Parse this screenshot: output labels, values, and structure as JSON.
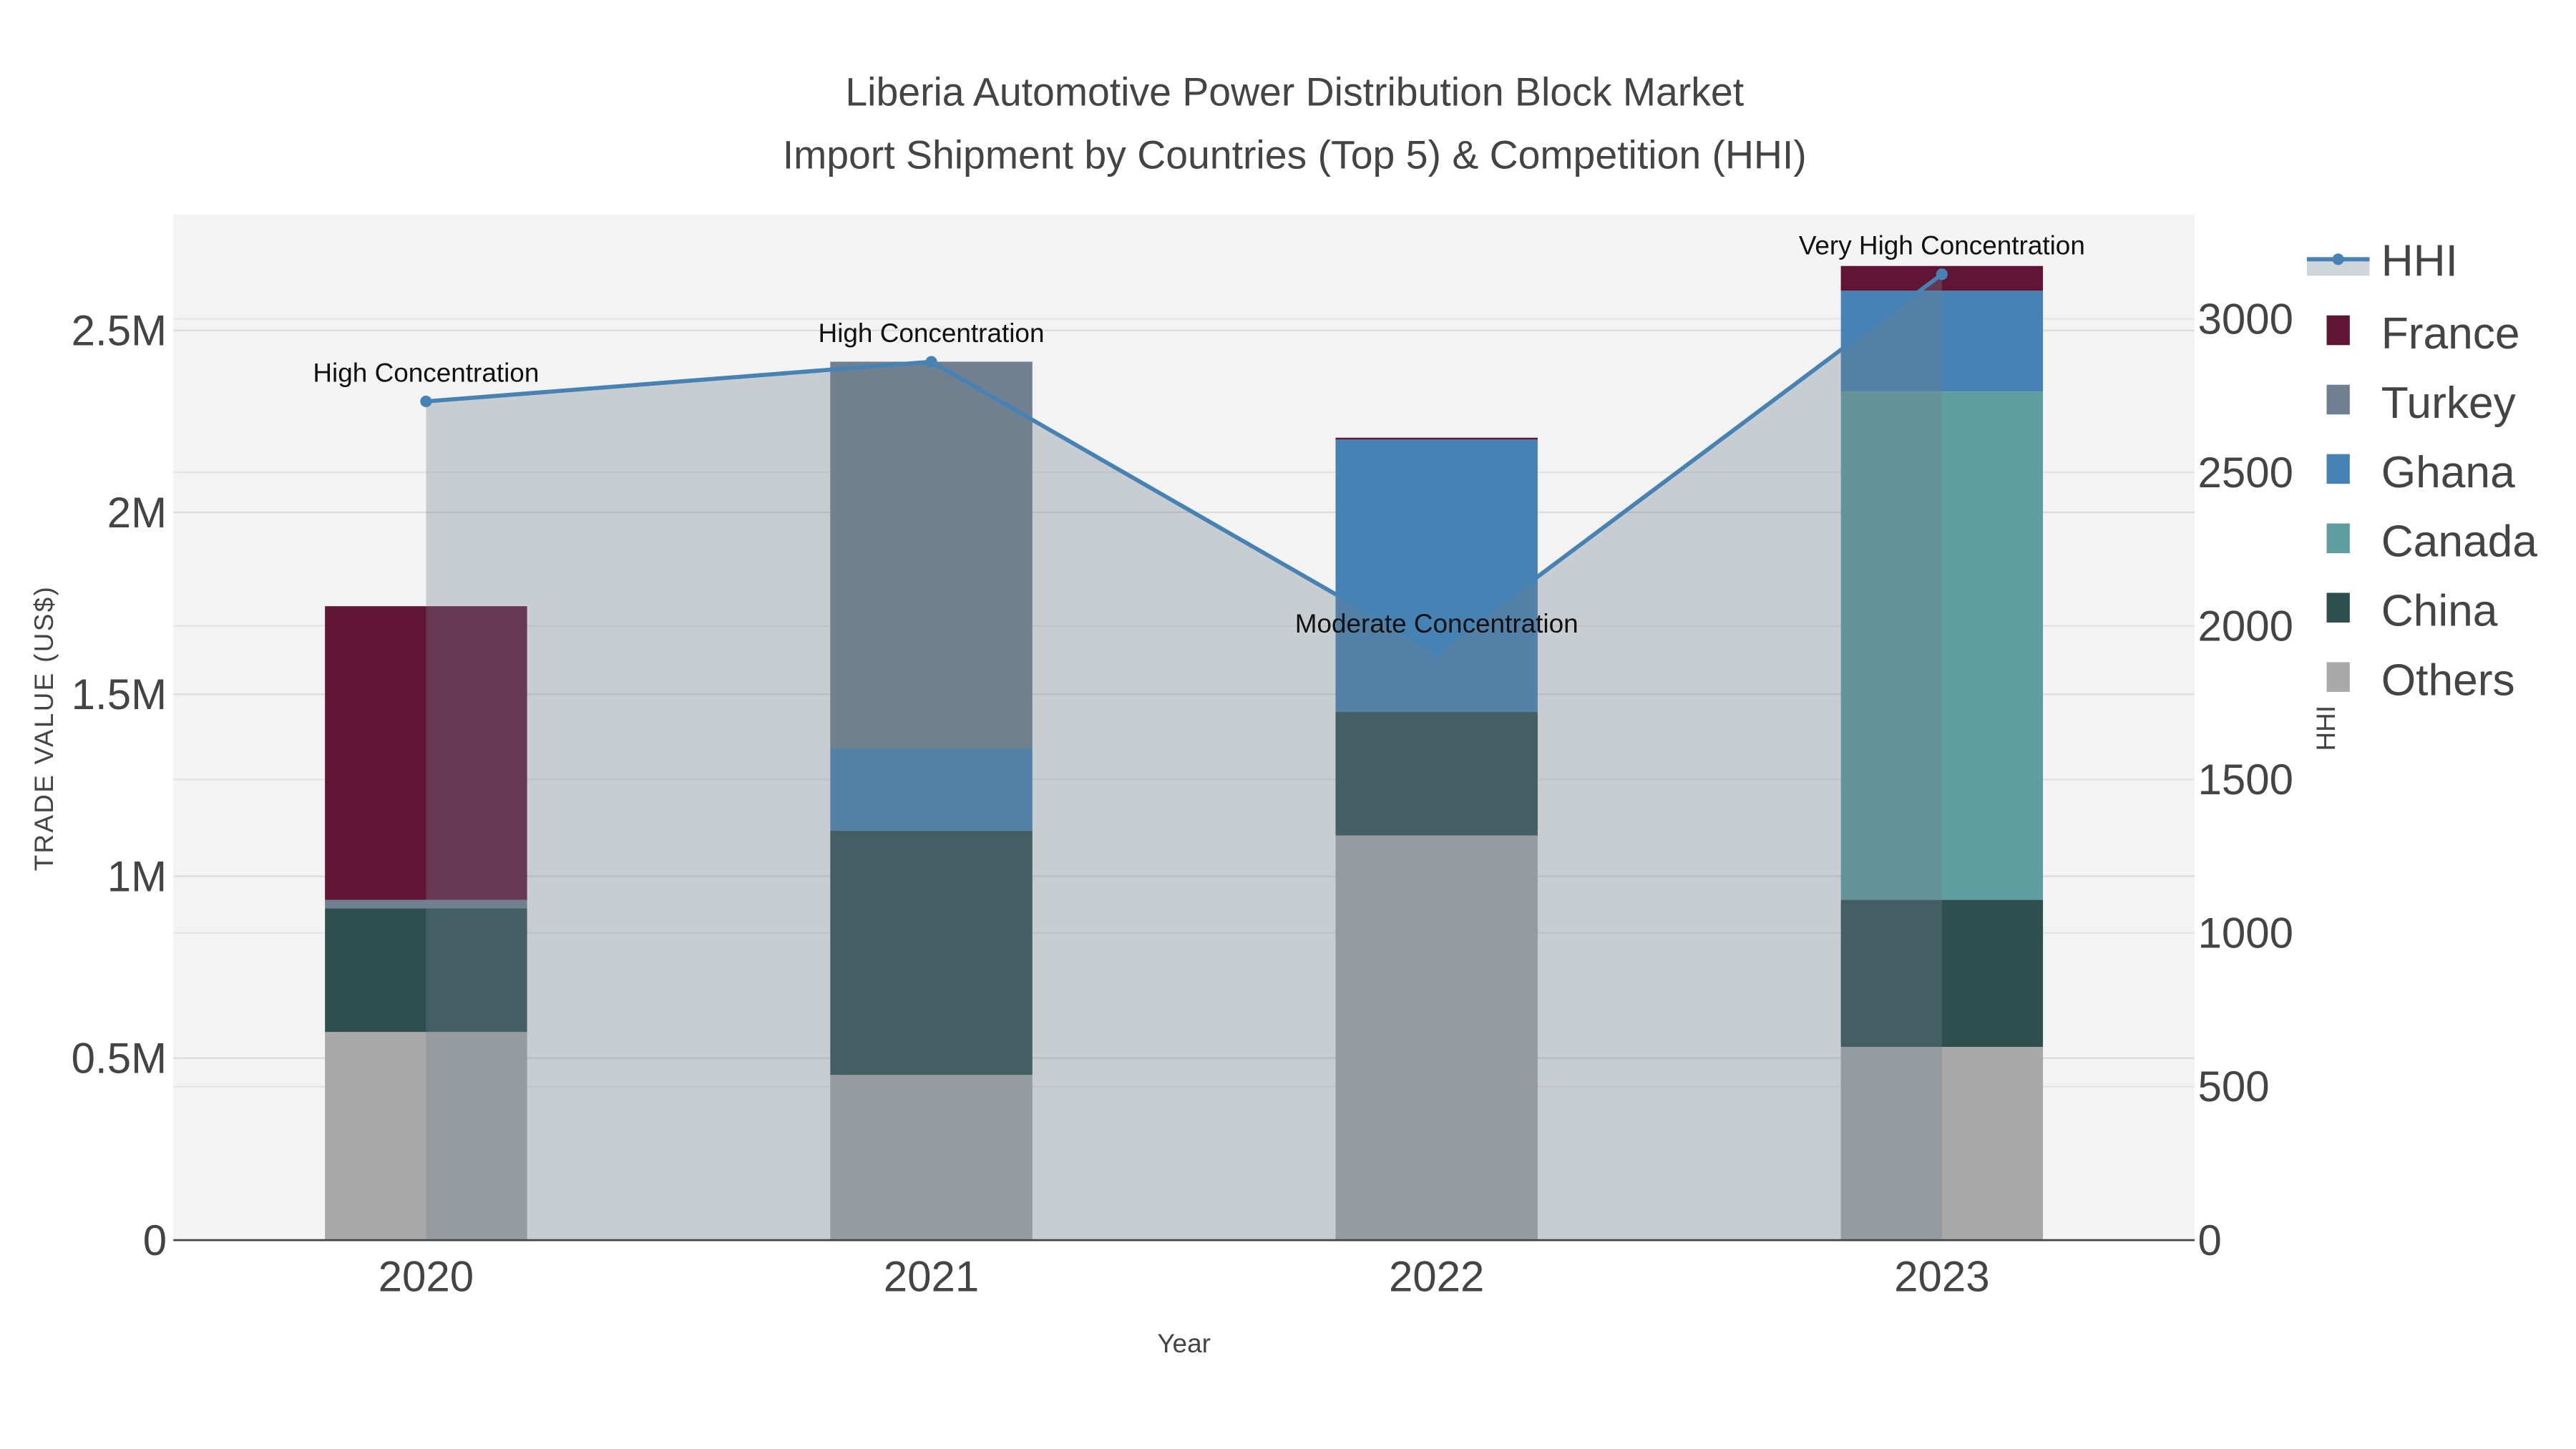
{
  "chart_data": {
    "type": "bar",
    "title_line1": "Liberia Automotive Power Distribution Block Market",
    "title_line2": "Import Shipment by Countries (Top 5) & Competition (HHI)",
    "xlabel": "Year",
    "ylabel": "TRADE VALUE (US$)",
    "y2label": "HHI",
    "categories": [
      "2020",
      "2021",
      "2022",
      "2023"
    ],
    "ylim": [
      0,
      2818000
    ],
    "y2lim": [
      0,
      3339
    ],
    "yticks": [
      {
        "v": 0,
        "label": "0"
      },
      {
        "v": 500000,
        "label": "0.5M"
      },
      {
        "v": 1000000,
        "label": "1M"
      },
      {
        "v": 1500000,
        "label": "1.5M"
      },
      {
        "v": 2000000,
        "label": "2M"
      },
      {
        "v": 2500000,
        "label": "2.5M"
      }
    ],
    "y2ticks": [
      {
        "v": 0,
        "label": "0"
      },
      {
        "v": 500,
        "label": "500"
      },
      {
        "v": 1000,
        "label": "1000"
      },
      {
        "v": 1500,
        "label": "1500"
      },
      {
        "v": 2000,
        "label": "2000"
      },
      {
        "v": 2500,
        "label": "2500"
      },
      {
        "v": 3000,
        "label": "3000"
      }
    ],
    "series": [
      {
        "name": "Others",
        "color": "#a9a9a9",
        "values": [
          572000,
          454000,
          1112000,
          531000
        ]
      },
      {
        "name": "China",
        "color": "#2f4f4f",
        "values": [
          340000,
          671000,
          340000,
          404000
        ]
      },
      {
        "name": "Canada",
        "color": "#5f9ea0",
        "values": [
          0,
          0,
          0,
          1397000
        ]
      },
      {
        "name": "Ghana",
        "color": "#4682b4",
        "values": [
          0,
          227000,
          748000,
          277000
        ]
      },
      {
        "name": "Turkey",
        "color": "#708090",
        "values": [
          23000,
          1062000,
          0,
          0
        ]
      },
      {
        "name": "France",
        "color": "#611535",
        "values": [
          807000,
          0,
          5000,
          68000
        ]
      }
    ],
    "hhi": {
      "name": "HHI",
      "color": "#4682b4",
      "values": [
        2731,
        2860,
        1914,
        3145
      ]
    },
    "annotations": [
      "High Concentration",
      "High Concentration",
      "Moderate Concentration",
      "Very High Concentration"
    ],
    "legend_order": [
      "HHI",
      "France",
      "Turkey",
      "Ghana",
      "Canada",
      "China",
      "Others"
    ],
    "legend_position": "right",
    "grid": true
  }
}
